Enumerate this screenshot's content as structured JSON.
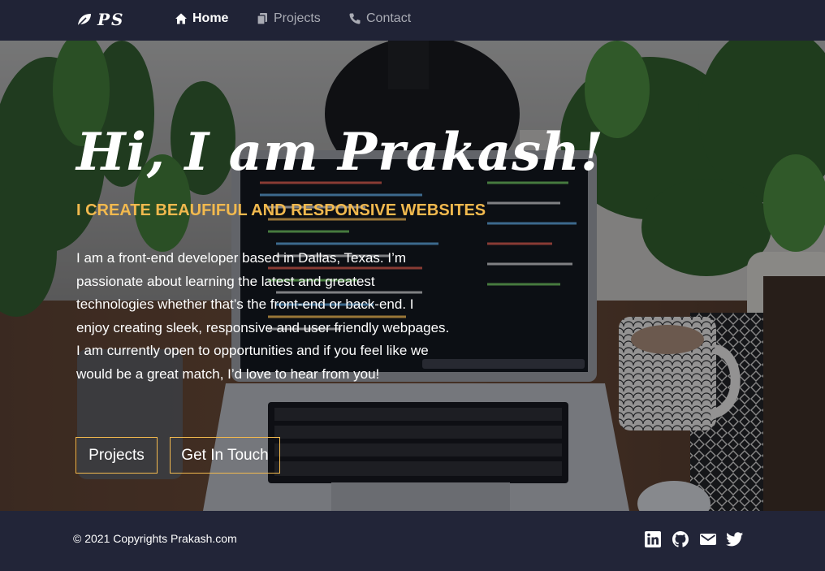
{
  "nav": {
    "logo_text": "PS",
    "items": [
      {
        "label": "Home",
        "icon": "home-icon",
        "active": true
      },
      {
        "label": "Projects",
        "icon": "copy-icon",
        "active": false
      },
      {
        "label": "Contact",
        "icon": "phone-icon",
        "active": false
      }
    ]
  },
  "hero": {
    "title": "Hi, I am Prakash!",
    "subtitle": "I CREATE BEAUFIFUL AND RESPONSIVE WEBSITES",
    "description": "I am a front-end developer based in Dallas, Texas. I’m passionate about learning the latest and greatest technologies whether that’s the front-end or back-end. I enjoy creating sleek, responsive and user friendly webpages. I am currently open to opportunities and if you feel like we would be a great match, I’d love to hear from you!",
    "buttons": [
      {
        "label": "Projects"
      },
      {
        "label": "Get In Touch"
      }
    ]
  },
  "footer": {
    "copyright": "© 2021 Copyrights Prakash.com",
    "social": [
      "linkedin-icon",
      "github-icon",
      "mail-icon",
      "twitter-icon"
    ]
  },
  "colors": {
    "nav_bg": "#202336",
    "footer_bg": "#222538",
    "accent": "#f2b94e",
    "text": "#ffffff",
    "nav_inactive": "#a9abb4"
  }
}
